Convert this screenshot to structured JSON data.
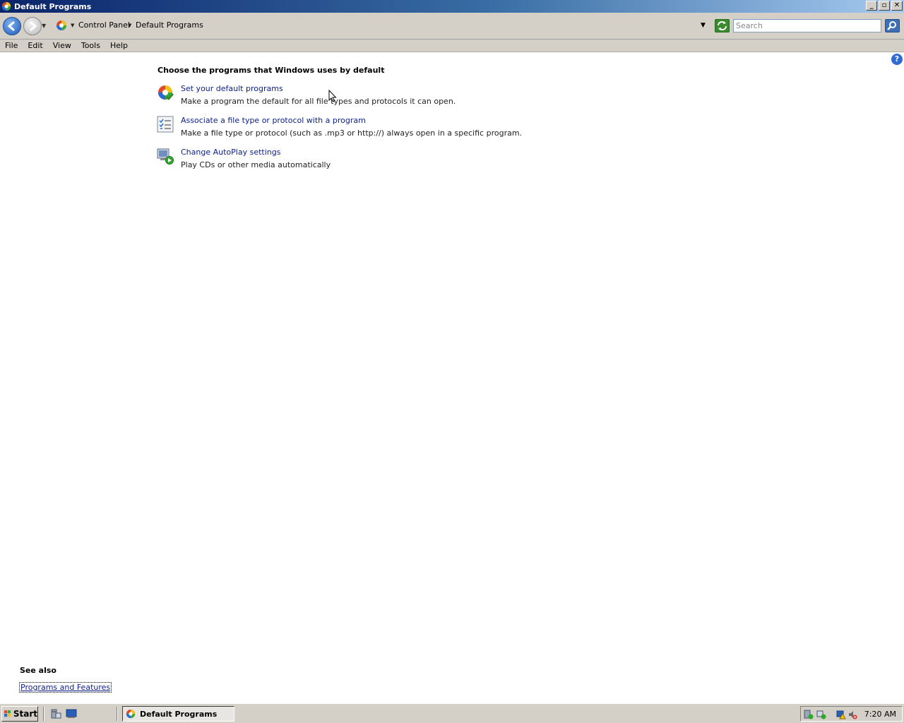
{
  "window": {
    "title": "Default Programs",
    "buttons": {
      "minimize": "_",
      "maximize": "▫",
      "close": "✕"
    }
  },
  "address": {
    "crumbs": [
      "Control Panel",
      "Default Programs"
    ],
    "search_placeholder": "Search"
  },
  "menu": [
    "File",
    "Edit",
    "View",
    "Tools",
    "Help"
  ],
  "main": {
    "heading": "Choose the programs that Windows uses by default",
    "tasks": [
      {
        "link": "Set your default programs",
        "description": "Make a program the default for all file types and protocols it can open.",
        "icon": "default-programs-icon"
      },
      {
        "link": "Associate a file type or protocol with a program",
        "description": "Make a file type or protocol (such as .mp3 or http://) always open in a specific program.",
        "icon": "file-association-icon"
      },
      {
        "link": "Change AutoPlay settings",
        "description": "Play CDs or other media automatically",
        "icon": "autoplay-icon"
      }
    ],
    "see_also_title": "See also",
    "see_also_link": "Programs and Features"
  },
  "taskbar": {
    "start_label": "Start",
    "active_window": "Default Programs",
    "clock": "7:20 AM"
  }
}
